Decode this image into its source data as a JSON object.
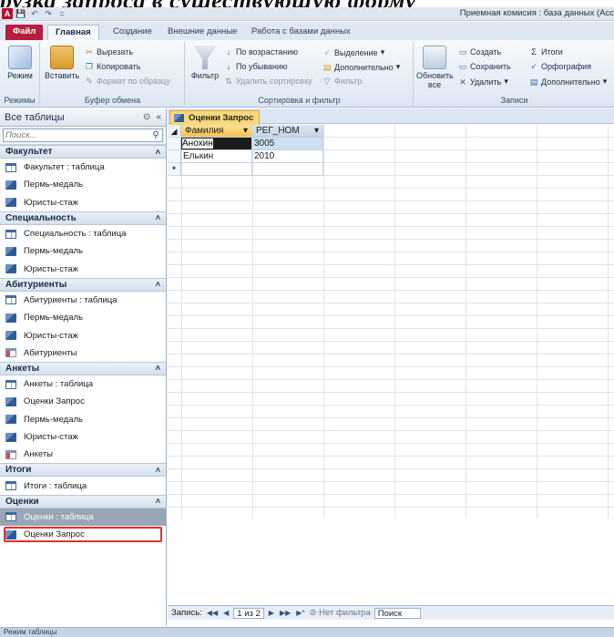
{
  "caption": "рузка запроса в существующую форму",
  "titlebar": {
    "title": "Приемная комисия : база данных (Acc",
    "qat": [
      "A",
      "💾",
      "↶",
      "↷",
      "="
    ]
  },
  "ribbon_tabs": [
    "Файл",
    "Главная",
    "Создание",
    "Внешние данные",
    "Работа с базами данных"
  ],
  "ribbon": {
    "groups": {
      "modes": "Режимы",
      "clipboard": "Буфер обмена",
      "sort_filter": "Сортировка и фильтр",
      "records": "Записи"
    },
    "mode_button": "Режим",
    "paste_button": "Вставить",
    "cut": "Вырезать",
    "copy": "Копировать",
    "format_painter": "Формат по образцу",
    "filter_button": "Фильтр",
    "sort_asc": "По возрастанию",
    "sort_desc": "По убыванию",
    "remove_sort": "Удалить сортировку",
    "selection": "Выделение",
    "advanced": "Дополнительно",
    "toggle_filter": "Фильтр",
    "refresh_all": "Обновить все",
    "new": "Создать",
    "save": "Сохранить",
    "delete": "Удалить",
    "totals": "Итоги",
    "spelling": "Орфография",
    "more": "Дополнительно"
  },
  "nav_pane": {
    "title": "Все таблицы",
    "search_placeholder": "Поиск...",
    "groups": [
      {
        "name": "Факультет",
        "items": [
          {
            "label": "Факультет : таблица",
            "icon": "table"
          },
          {
            "label": "Пермь-медаль",
            "icon": "query"
          },
          {
            "label": "Юристы-стаж",
            "icon": "query"
          }
        ]
      },
      {
        "name": "Специальность",
        "items": [
          {
            "label": "Специальность : таблица",
            "icon": "table"
          },
          {
            "label": "Пермь-медаль",
            "icon": "query"
          },
          {
            "label": "Юристы-стаж",
            "icon": "query"
          }
        ]
      },
      {
        "name": "Абитуриенты",
        "items": [
          {
            "label": "Абитуриенты : таблица",
            "icon": "table"
          },
          {
            "label": "Пермь-медаль",
            "icon": "query"
          },
          {
            "label": "Юристы-стаж",
            "icon": "query"
          },
          {
            "label": "Абитуриенты",
            "icon": "form"
          }
        ]
      },
      {
        "name": "Анкеты",
        "items": [
          {
            "label": "Анкеты : таблица",
            "icon": "table"
          },
          {
            "label": "Оценки Запрос",
            "icon": "query"
          },
          {
            "label": "Пермь-медаль",
            "icon": "query"
          },
          {
            "label": "Юристы-стаж",
            "icon": "query"
          },
          {
            "label": "Анкеты",
            "icon": "form"
          }
        ]
      },
      {
        "name": "Итоги",
        "items": [
          {
            "label": "Итоги : таблица",
            "icon": "table"
          }
        ]
      },
      {
        "name": "Оценки",
        "items": [
          {
            "label": "Оценки : таблица",
            "icon": "table",
            "selected": true
          },
          {
            "label": "Оценки Запрос",
            "icon": "query",
            "highlighted": true
          }
        ]
      }
    ]
  },
  "document": {
    "tab_label": "Оценки Запрос",
    "columns": [
      "Фамилия",
      "РЕГ_НОМ"
    ],
    "rows": [
      [
        "Анохин",
        "3005"
      ],
      [
        "Елькин",
        "2010"
      ]
    ],
    "new_row_marker": "*"
  },
  "record_nav": {
    "label": "Запись:",
    "first": "◀◀",
    "prev": "◀",
    "position": "1 из 2",
    "next": "▶",
    "last": "▶▶",
    "new": "▶*",
    "filter": "Нет фильтра",
    "search": "Поиск"
  },
  "status_bar": "Режим таблицы",
  "colors": {
    "file_tab": "#b61d3e",
    "doc_tab": "#f9d87b",
    "highlight_outline": "#e0322b"
  }
}
